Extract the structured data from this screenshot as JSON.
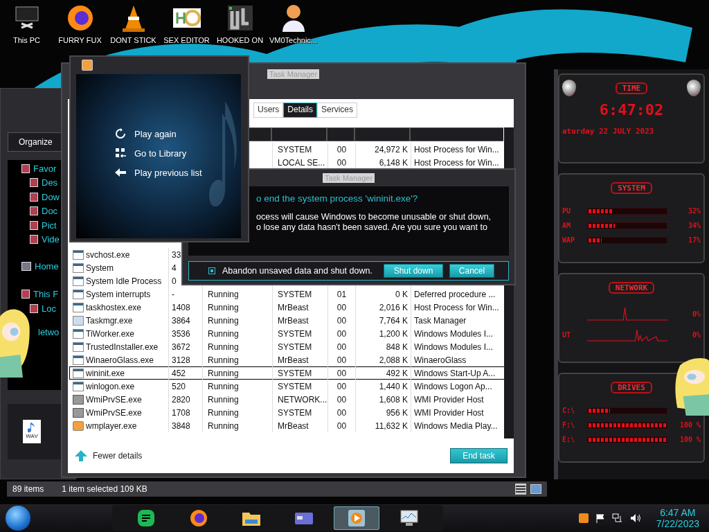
{
  "desktop_icons": [
    {
      "label": "This PC",
      "kind": "pc"
    },
    {
      "label": "FURRY FUX",
      "kind": "firefox"
    },
    {
      "label": "DONT STICK",
      "kind": "cone"
    },
    {
      "label": "SEX EDITOR",
      "kind": "hex"
    },
    {
      "label": "HOOKED ON",
      "kind": "maze"
    },
    {
      "label": "VM0Technic...",
      "kind": "person"
    }
  ],
  "explorer": {
    "toolbar": "Organize",
    "nav": [
      {
        "label": "Favor",
        "kind": "group"
      },
      {
        "label": "Des",
        "kind": "item"
      },
      {
        "label": "Dow",
        "kind": "item"
      },
      {
        "label": "Doc",
        "kind": "item"
      },
      {
        "label": "Pict",
        "kind": "item"
      },
      {
        "label": "Vide",
        "kind": "item"
      },
      {
        "label": "Home",
        "kind": "home"
      },
      {
        "label": "This F",
        "kind": "group"
      },
      {
        "label": "Loc",
        "kind": "item"
      },
      {
        "label": "letwo",
        "kind": "plain"
      }
    ],
    "file_type": "WAV",
    "item_count": "89 items",
    "selection": "1 item selected  109 KB"
  },
  "task_manager": {
    "title": "Task Manager",
    "tabs": [
      {
        "label": "Users",
        "selected": false
      },
      {
        "label": "Details",
        "selected": true
      },
      {
        "label": "Services",
        "selected": false
      }
    ],
    "rows": [
      {
        "user": "SYSTEM",
        "cpu": "00",
        "memory": "24,972 K",
        "description": "Host Process for Win...",
        "selected": false
      },
      {
        "user": "LOCAL SE...",
        "cpu": "00",
        "memory": "6,148 K",
        "description": "Host Process for Win...",
        "selected": false
      },
      {
        "kind": "app",
        "name": "svchost.exe",
        "pid": "33",
        "selected": false
      },
      {
        "kind": "app",
        "name": "System",
        "pid": "4",
        "selected": false
      },
      {
        "kind": "app",
        "name": "System Idle Process",
        "pid": "0",
        "selected": false
      },
      {
        "kind": "app",
        "name": "System interrupts",
        "pid": "-",
        "status": "Running",
        "user": "SYSTEM",
        "cpu": "01",
        "memory": "0 K",
        "description": "Deferred procedure ...",
        "selected": false
      },
      {
        "kind": "app",
        "name": "taskhostex.exe",
        "pid": "1408",
        "status": "Running",
        "user": "MrBeast",
        "cpu": "00",
        "memory": "2,016 K",
        "description": "Host Process for Win...",
        "selected": false
      },
      {
        "kind": "monitor",
        "name": "Taskmgr.exe",
        "pid": "3864",
        "status": "Running",
        "user": "MrBeast",
        "cpu": "00",
        "memory": "7,764 K",
        "description": "Task Manager",
        "selected": false
      },
      {
        "kind": "app",
        "name": "TiWorker.exe",
        "pid": "3536",
        "status": "Running",
        "user": "SYSTEM",
        "cpu": "00",
        "memory": "1,200 K",
        "description": "Windows Modules I...",
        "selected": false
      },
      {
        "kind": "app",
        "name": "TrustedInstaller.exe",
        "pid": "3672",
        "status": "Running",
        "user": "SYSTEM",
        "cpu": "00",
        "memory": "848 K",
        "description": "Windows Modules I...",
        "selected": false
      },
      {
        "kind": "app",
        "name": "WinaeroGlass.exe",
        "pid": "3128",
        "status": "Running",
        "user": "MrBeast",
        "cpu": "00",
        "memory": "2,088 K",
        "description": "WinaeroGlass",
        "selected": false
      },
      {
        "kind": "app",
        "name": "wininit.exe",
        "pid": "452",
        "status": "Running",
        "user": "SYSTEM",
        "cpu": "00",
        "memory": "492 K",
        "description": "Windows Start-Up A...",
        "selected": true
      },
      {
        "kind": "app",
        "name": "winlogon.exe",
        "pid": "520",
        "status": "Running",
        "user": "SYSTEM",
        "cpu": "00",
        "memory": "1,440 K",
        "description": "Windows Logon Ap...",
        "selected": false
      },
      {
        "kind": "service",
        "name": "WmiPrvSE.exe",
        "pid": "2820",
        "status": "Running",
        "user": "NETWORK...",
        "cpu": "00",
        "memory": "1,608 K",
        "description": "WMI Provider Host",
        "selected": false
      },
      {
        "kind": "service",
        "name": "WmiPrvSE.exe",
        "pid": "1708",
        "status": "Running",
        "user": "SYSTEM",
        "cpu": "00",
        "memory": "956 K",
        "description": "WMI Provider Host",
        "selected": false
      },
      {
        "kind": "player",
        "name": "wmplayer.exe",
        "pid": "3848",
        "status": "Running",
        "user": "MrBeast",
        "cpu": "00",
        "memory": "11,632 K",
        "description": "Windows Media Play...",
        "selected": false
      }
    ],
    "fewer_details": "Fewer details",
    "end_task": "End task"
  },
  "dialog": {
    "title": "Task Manager",
    "heading": "o end the system process 'wininit.exe'?",
    "body_lines": [
      "ocess will cause Windows to become unusable or shut down,",
      "o lose any data hasn't been saved. Are you sure you want to"
    ],
    "checkbox": {
      "label": "Abandon unsaved data and shut down.",
      "checked": true
    },
    "buttons": [
      "Shut down",
      "Cancel"
    ]
  },
  "media_player": {
    "items": [
      {
        "label": "Play again",
        "kind": "replay"
      },
      {
        "label": "Go to Library",
        "kind": "library"
      },
      {
        "label": "Play previous list",
        "kind": "back"
      }
    ]
  },
  "gadget": {
    "time_title": "TIME",
    "clock": "6:47:02",
    "date": "aturday 22 JULY 2023",
    "system_title": "SYSTEM",
    "system": [
      {
        "label": "PU",
        "level": 0.32,
        "reading": "32%"
      },
      {
        "label": "AM",
        "level": 0.34,
        "reading": "34%"
      },
      {
        "label": "WAP",
        "level": 0.17,
        "reading": "17%"
      }
    ],
    "network_title": "NETWORK",
    "network": [
      {
        "reading": "0%"
      },
      {
        "label": "UT",
        "reading": "0%"
      }
    ],
    "drives_title": "DRIVES",
    "drives": [
      {
        "label": "C:\\",
        "level": 0.28
      },
      {
        "label": "F:\\",
        "level": 1,
        "reading": "100 %"
      },
      {
        "label": "E:\\",
        "level": 1,
        "reading": "100 %"
      }
    ]
  },
  "taskbar": {
    "apps": [
      {
        "kind": "notes",
        "active": false
      },
      {
        "kind": "firefox",
        "active": false
      },
      {
        "kind": "folder",
        "active": false
      },
      {
        "kind": "card",
        "active": false
      },
      {
        "kind": "player",
        "active": true
      },
      {
        "kind": "monitor",
        "active": false
      }
    ],
    "time": "6:47 AM",
    "date": "7/22/2023"
  }
}
